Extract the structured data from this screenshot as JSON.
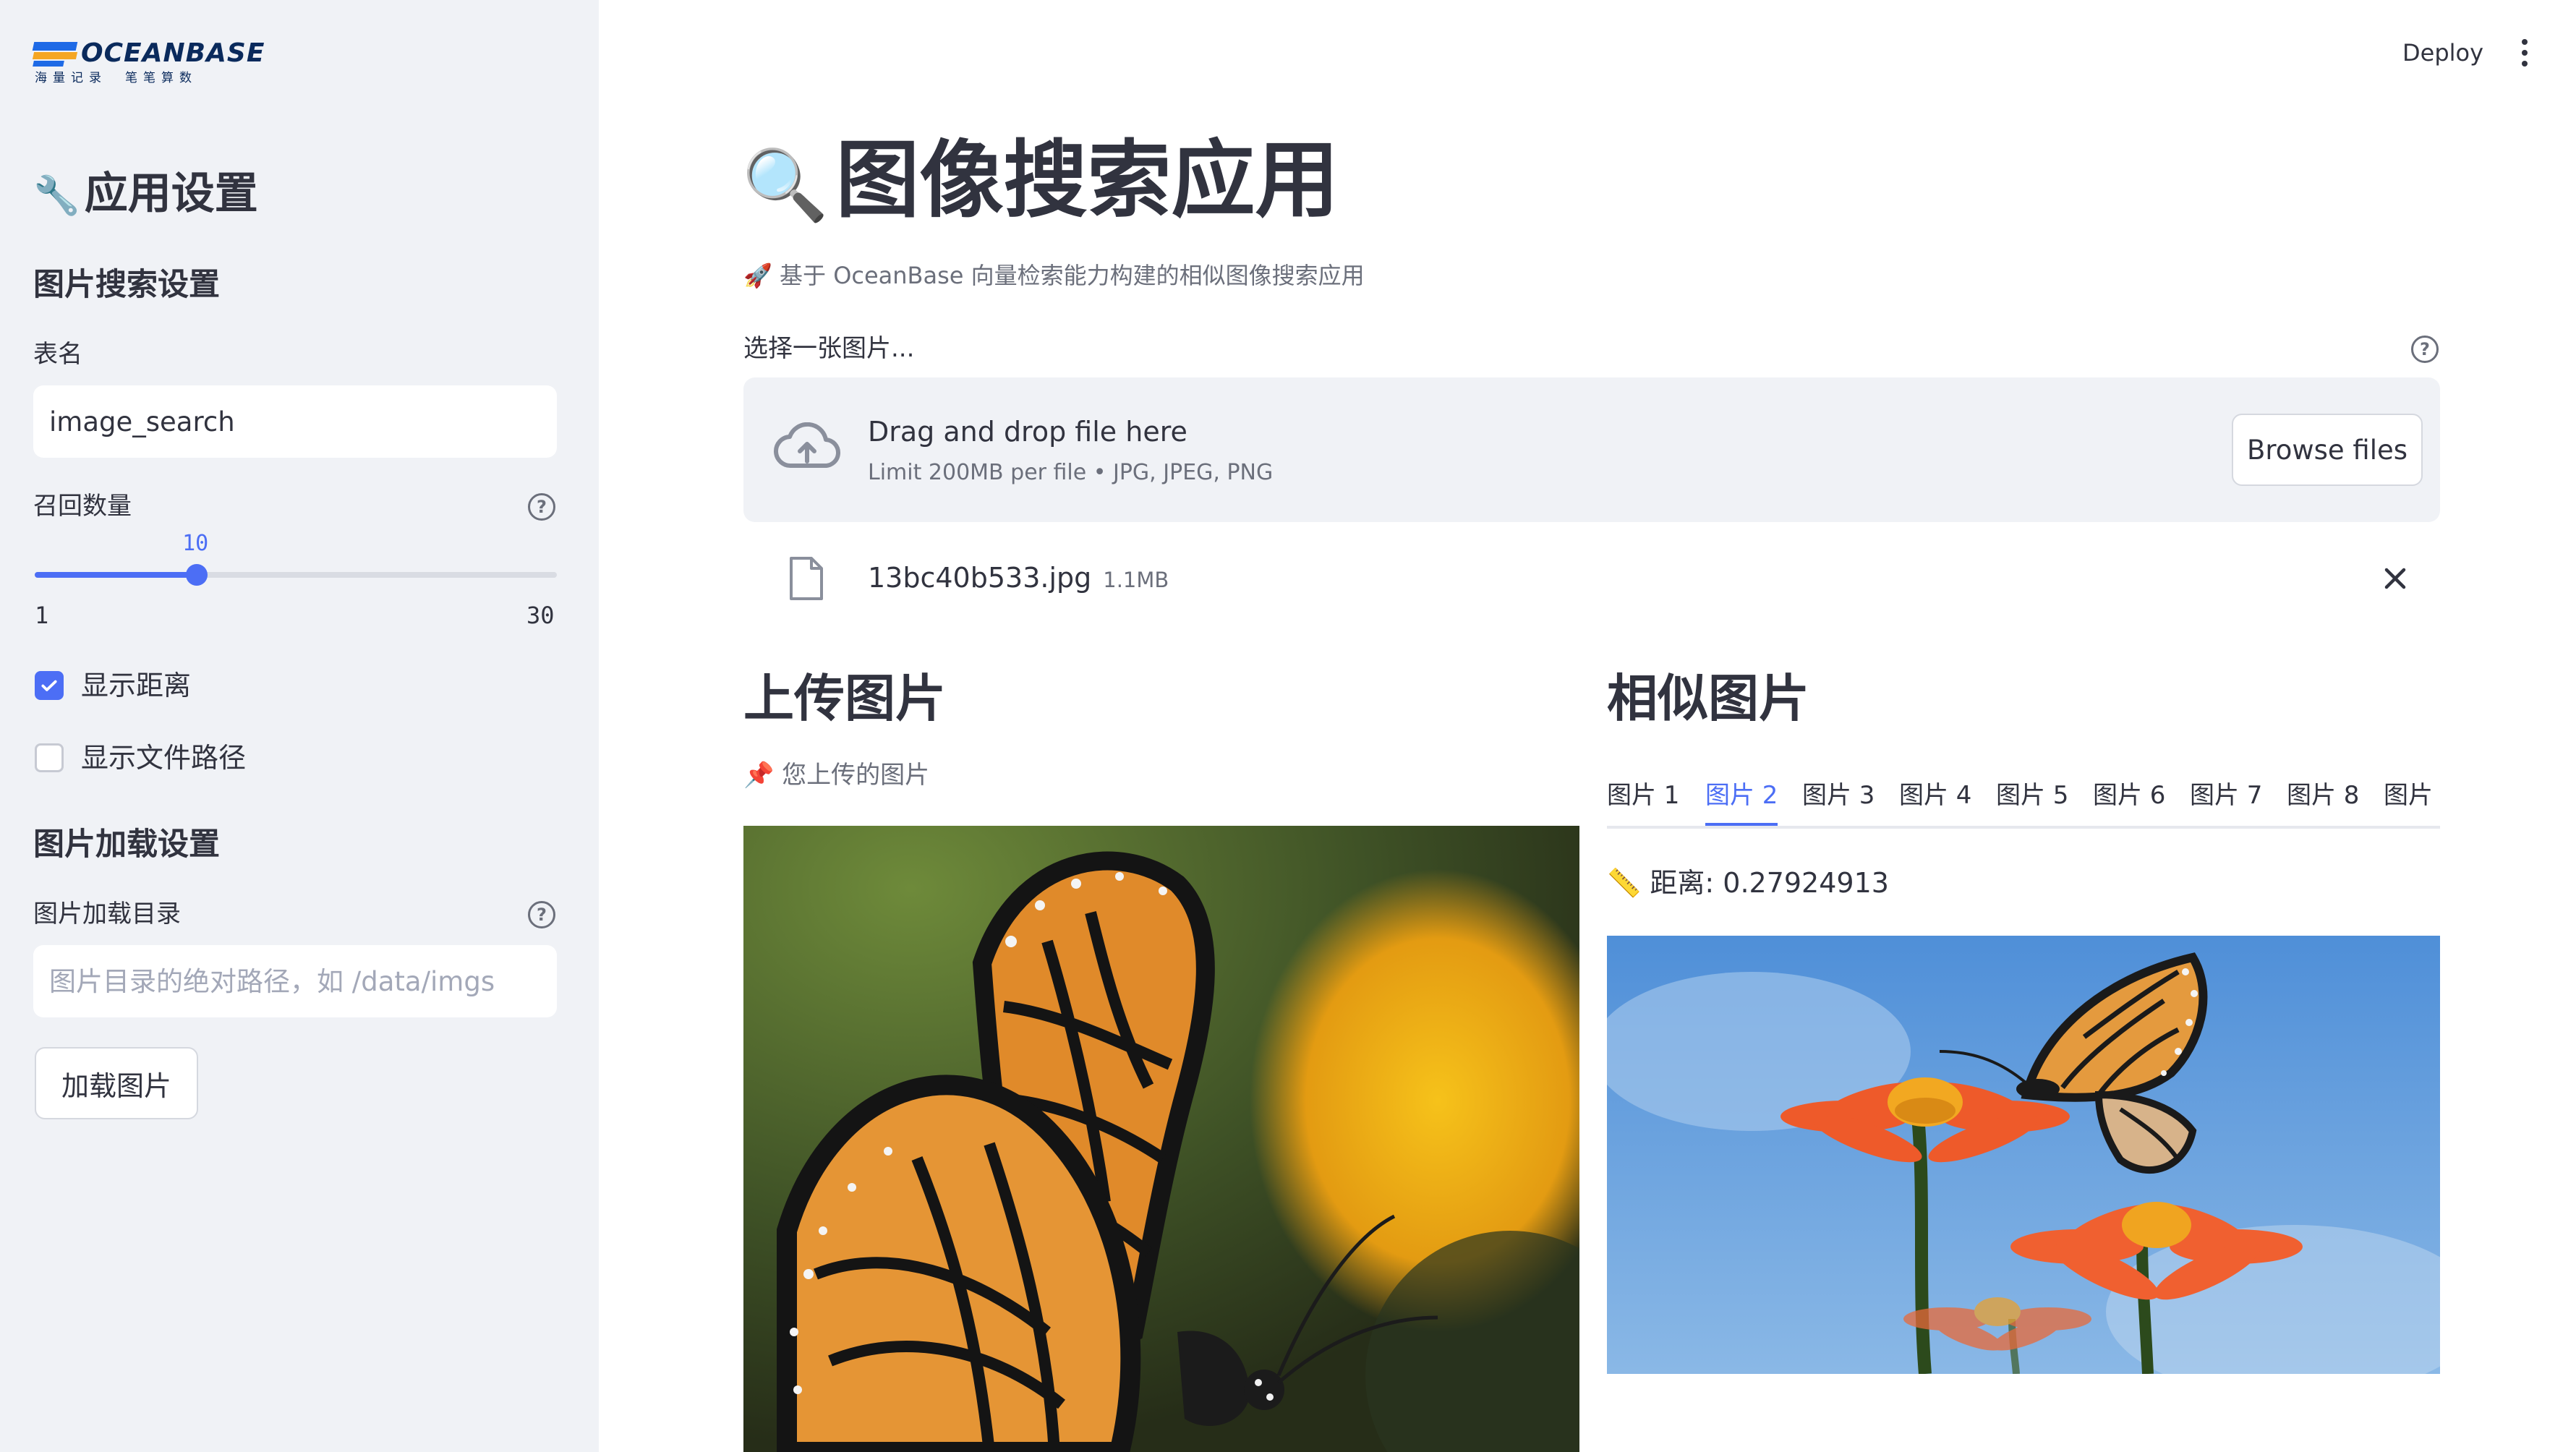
{
  "app": {
    "deploy_label": "Deploy"
  },
  "sidebar": {
    "logo": {
      "brand": "OCEANBASE",
      "tagline": "海量记录　笔笔算数"
    },
    "title_emoji": "🔧",
    "title": "应用设置",
    "search_section_title": "图片搜索设置",
    "table_name_label": "表名",
    "table_name_value": "image_search",
    "recall_label": "召回数量",
    "recall_slider": {
      "value": "10",
      "min": "1",
      "max": "30",
      "value_num": 10,
      "min_num": 1,
      "max_num": 30
    },
    "show_distance_label": "显示距离",
    "show_distance_checked": true,
    "show_path_label": "显示文件路径",
    "show_path_checked": false,
    "load_section_title": "图片加载设置",
    "load_dir_label": "图片加载目录",
    "load_dir_placeholder": "图片目录的绝对路径，如 /data/imgs",
    "load_button_label": "加载图片"
  },
  "main": {
    "title_emoji": "🔍",
    "title": "图像搜索应用",
    "subtitle": "🚀 基于 OceanBase 向量检索能力构建的相似图像搜索应用",
    "uploader": {
      "label": "选择一张图片...",
      "drop_text": "Drag and drop file here",
      "limit_text": "Limit 200MB per file • JPG, JPEG, PNG",
      "browse_label": "Browse files"
    },
    "uploaded_file": {
      "name": "13bc40b533.jpg",
      "size": "1.1MB"
    },
    "upload_column": {
      "heading": "上传图片",
      "caption": "📌 您上传的图片"
    },
    "similar_column": {
      "heading": "相似图片",
      "tabs": [
        "图片 1",
        "图片 2",
        "图片 3",
        "图片 4",
        "图片 5",
        "图片 6",
        "图片 7",
        "图片 8",
        "图片"
      ],
      "active_tab_index": 1,
      "distance_text": "📏 距离: 0.27924913"
    }
  },
  "colors": {
    "accent": "#4c6ef5",
    "sidebar_bg": "#f0f2f6",
    "text": "#31333f",
    "muted": "#6b6f7b"
  },
  "icons": [
    "help-icon",
    "cloud-upload-icon",
    "file-icon",
    "close-icon",
    "kebab-menu-icon",
    "checkmark-icon"
  ]
}
